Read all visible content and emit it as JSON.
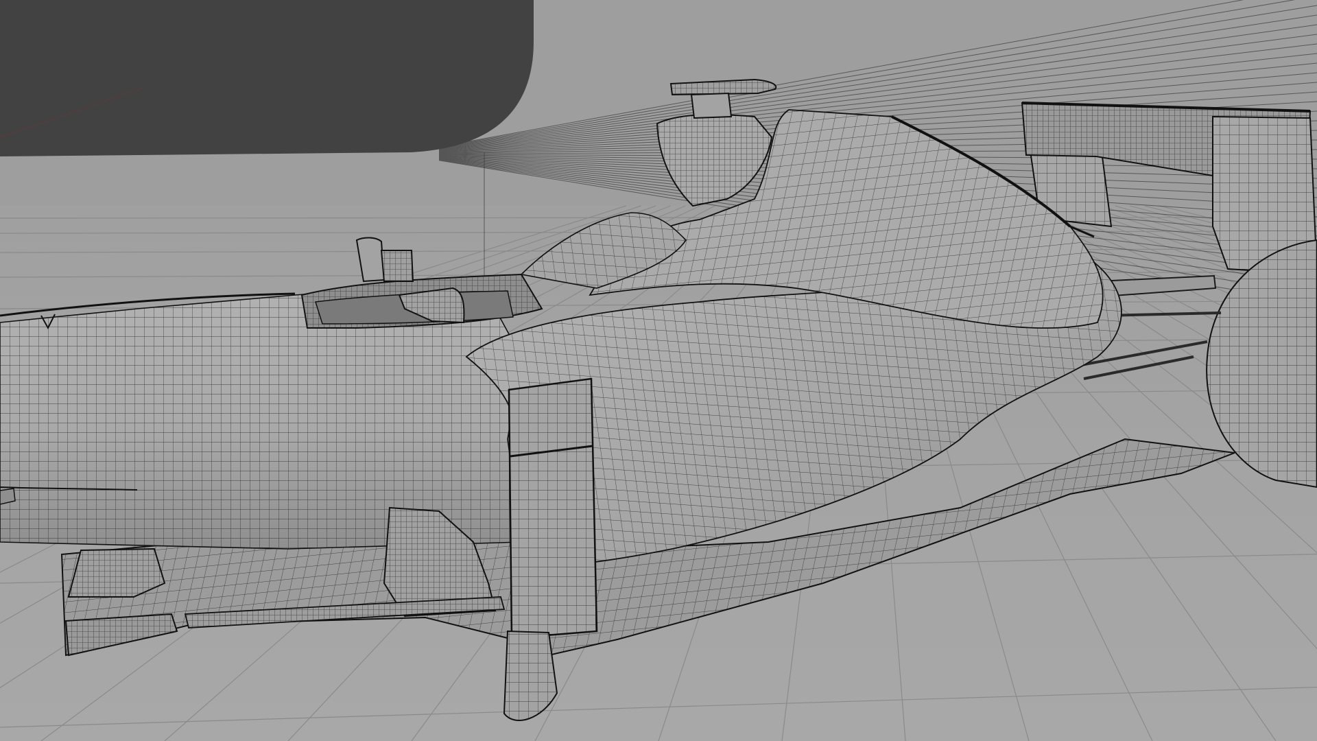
{
  "app": {
    "name": "",
    "view": "3d-viewport"
  },
  "viewport": {
    "background_color": "#9d9d9d",
    "floor_color": "#a3a3a3",
    "grid_line_color": "#8a8a8a",
    "wire_color": "#1a1a1a",
    "panel_color": "#424242",
    "model": {
      "subject": "formula-1-car",
      "display_mode": "wireframe-overlay",
      "visible_parts": [
        "nose",
        "cockpit",
        "halo-mount",
        "mirror",
        "sidepod",
        "bargeboards",
        "floor",
        "engine-cover",
        "airbox",
        "rear-wing",
        "rear-tyre"
      ]
    },
    "overlay_panel": {
      "visible": true,
      "color": "#424242"
    }
  }
}
